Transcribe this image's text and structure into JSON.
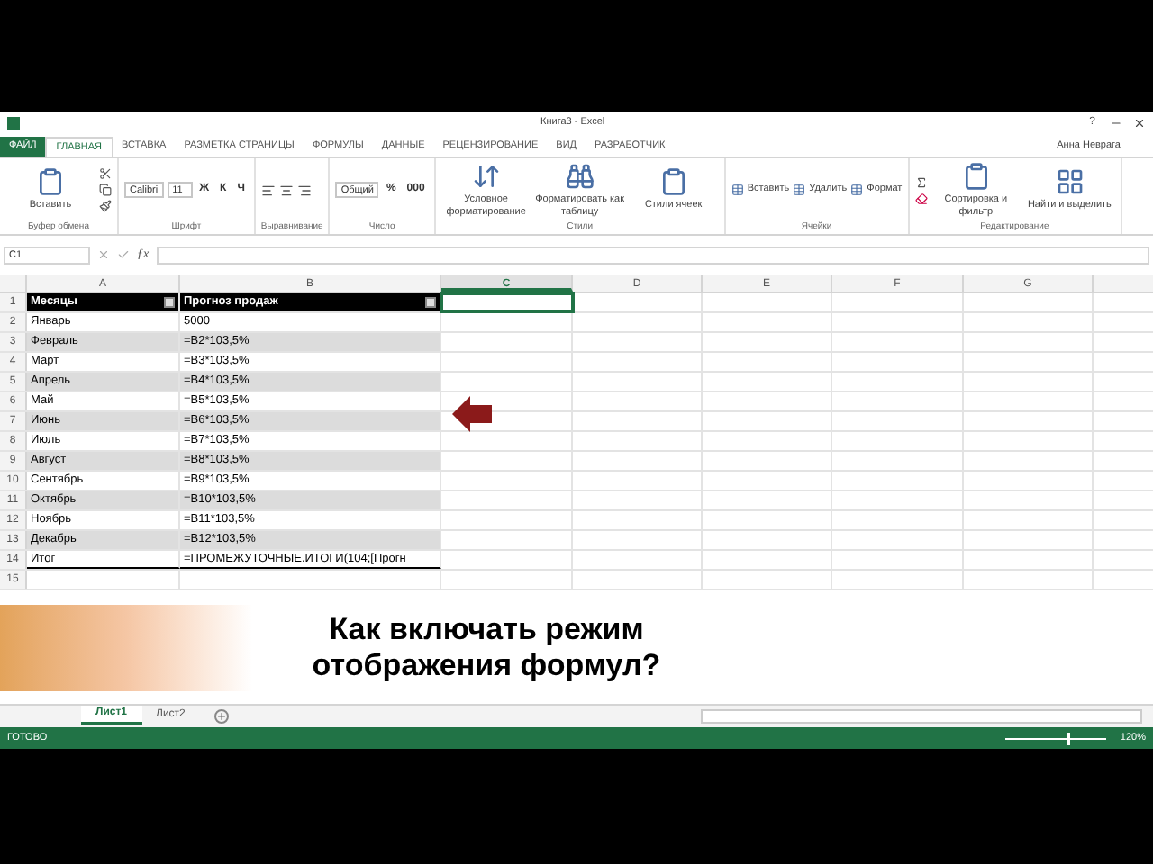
{
  "window": {
    "title": "Книга3 - Excel",
    "help": "?",
    "user": "Анна Неврага"
  },
  "tabs": [
    {
      "label": "ФАЙЛ",
      "kind": "file",
      "selected": false
    },
    {
      "label": "ГЛАВНАЯ",
      "kind": "tab",
      "selected": true
    },
    {
      "label": "ВСТАВКА",
      "kind": "tab",
      "selected": false
    },
    {
      "label": "РАЗМЕТКА СТРАНИЦЫ",
      "kind": "tab",
      "selected": false
    },
    {
      "label": "ФОРМУЛЫ",
      "kind": "tab",
      "selected": false
    },
    {
      "label": "ДАННЫЕ",
      "kind": "tab",
      "selected": false
    },
    {
      "label": "РЕЦЕНЗИРОВАНИЕ",
      "kind": "tab",
      "selected": false
    },
    {
      "label": "ВИД",
      "kind": "tab",
      "selected": false
    },
    {
      "label": "РАЗРАБОТЧИК",
      "kind": "tab",
      "selected": false
    }
  ],
  "ribbon": {
    "groups": [
      {
        "label": "Буфер обмена",
        "items": [
          {
            "kind": "big",
            "label": "Вставить"
          }
        ]
      },
      {
        "label": "Шрифт",
        "items": [
          {
            "kind": "field",
            "value": "Calibri"
          },
          {
            "kind": "field",
            "value": "11"
          },
          {
            "kind": "glyph",
            "label": "Ж"
          },
          {
            "kind": "glyph",
            "label": "К"
          },
          {
            "kind": "glyph",
            "label": "Ч"
          }
        ]
      },
      {
        "label": "Выравнивание"
      },
      {
        "label": "Число",
        "items": [
          {
            "kind": "field",
            "value": "Общий"
          },
          {
            "kind": "glyph",
            "label": "%"
          },
          {
            "kind": "glyph",
            "label": "000"
          }
        ]
      },
      {
        "label": "Стили",
        "items": [
          {
            "kind": "big",
            "label": "Условное форматирование"
          },
          {
            "kind": "big",
            "label": "Форматировать как таблицу"
          },
          {
            "kind": "big",
            "label": "Стили ячеек"
          }
        ]
      },
      {
        "label": "Ячейки",
        "items": [
          {
            "kind": "small",
            "label": "Вставить"
          },
          {
            "kind": "small",
            "label": "Удалить"
          },
          {
            "kind": "small",
            "label": "Формат"
          }
        ]
      },
      {
        "label": "Редактирование",
        "items": [
          {
            "kind": "big",
            "label": "Сортировка и фильтр"
          },
          {
            "kind": "big",
            "label": "Найти и выделить"
          }
        ]
      }
    ]
  },
  "formula_bar": {
    "name_box": "C1",
    "function_label": "ƒx"
  },
  "columns": [
    {
      "label": "A",
      "selected": false
    },
    {
      "label": "B",
      "selected": false
    },
    {
      "label": "C",
      "selected": true
    },
    {
      "label": "D",
      "selected": false
    },
    {
      "label": "E",
      "selected": false
    },
    {
      "label": "F",
      "selected": false
    },
    {
      "label": "G",
      "selected": false
    }
  ],
  "rows": [
    {
      "number": "1",
      "kind": "header",
      "cells": [
        "Месяцы",
        "Прогноз продаж"
      ]
    },
    {
      "number": "2",
      "kind": "data",
      "cells": [
        "Январь",
        "5000"
      ]
    },
    {
      "number": "3",
      "kind": "data",
      "cells": [
        "Февраль",
        "=B2*103,5%"
      ]
    },
    {
      "number": "4",
      "kind": "data",
      "cells": [
        "Март",
        "=B3*103,5%"
      ]
    },
    {
      "number": "5",
      "kind": "data",
      "cells": [
        "Апрель",
        "=B4*103,5%"
      ]
    },
    {
      "number": "6",
      "kind": "data",
      "cells": [
        "Май",
        "=B5*103,5%"
      ]
    },
    {
      "number": "7",
      "kind": "data",
      "cells": [
        "Июнь",
        "=B6*103,5%"
      ]
    },
    {
      "number": "8",
      "kind": "data",
      "cells": [
        "Июль",
        "=B7*103,5%"
      ]
    },
    {
      "number": "9",
      "kind": "data",
      "cells": [
        "Август",
        "=B8*103,5%"
      ]
    },
    {
      "number": "10",
      "kind": "data",
      "cells": [
        "Сентябрь",
        "=B9*103,5%"
      ]
    },
    {
      "number": "11",
      "kind": "data",
      "cells": [
        "Октябрь",
        "=B10*103,5%"
      ]
    },
    {
      "number": "12",
      "kind": "data",
      "cells": [
        "Ноябрь",
        "=B11*103,5%"
      ]
    },
    {
      "number": "13",
      "kind": "data",
      "cells": [
        "Декабрь",
        "=B12*103,5%"
      ]
    },
    {
      "number": "14",
      "kind": "total",
      "cells": [
        "Итог",
        "=ПРОМЕЖУТОЧНЫЕ.ИТОГИ(104;[Прогн"
      ]
    },
    {
      "number": "15",
      "kind": "empty",
      "cells": []
    }
  ],
  "banner": {
    "text": "Как включать режим отображения формул?"
  },
  "sheets": [
    {
      "label": "Лист1",
      "selected": true
    },
    {
      "label": "Лист2",
      "selected": false
    }
  ],
  "status_bar": {
    "status": "ГОТОВО",
    "zoom": "120%",
    "level": 0.6
  }
}
